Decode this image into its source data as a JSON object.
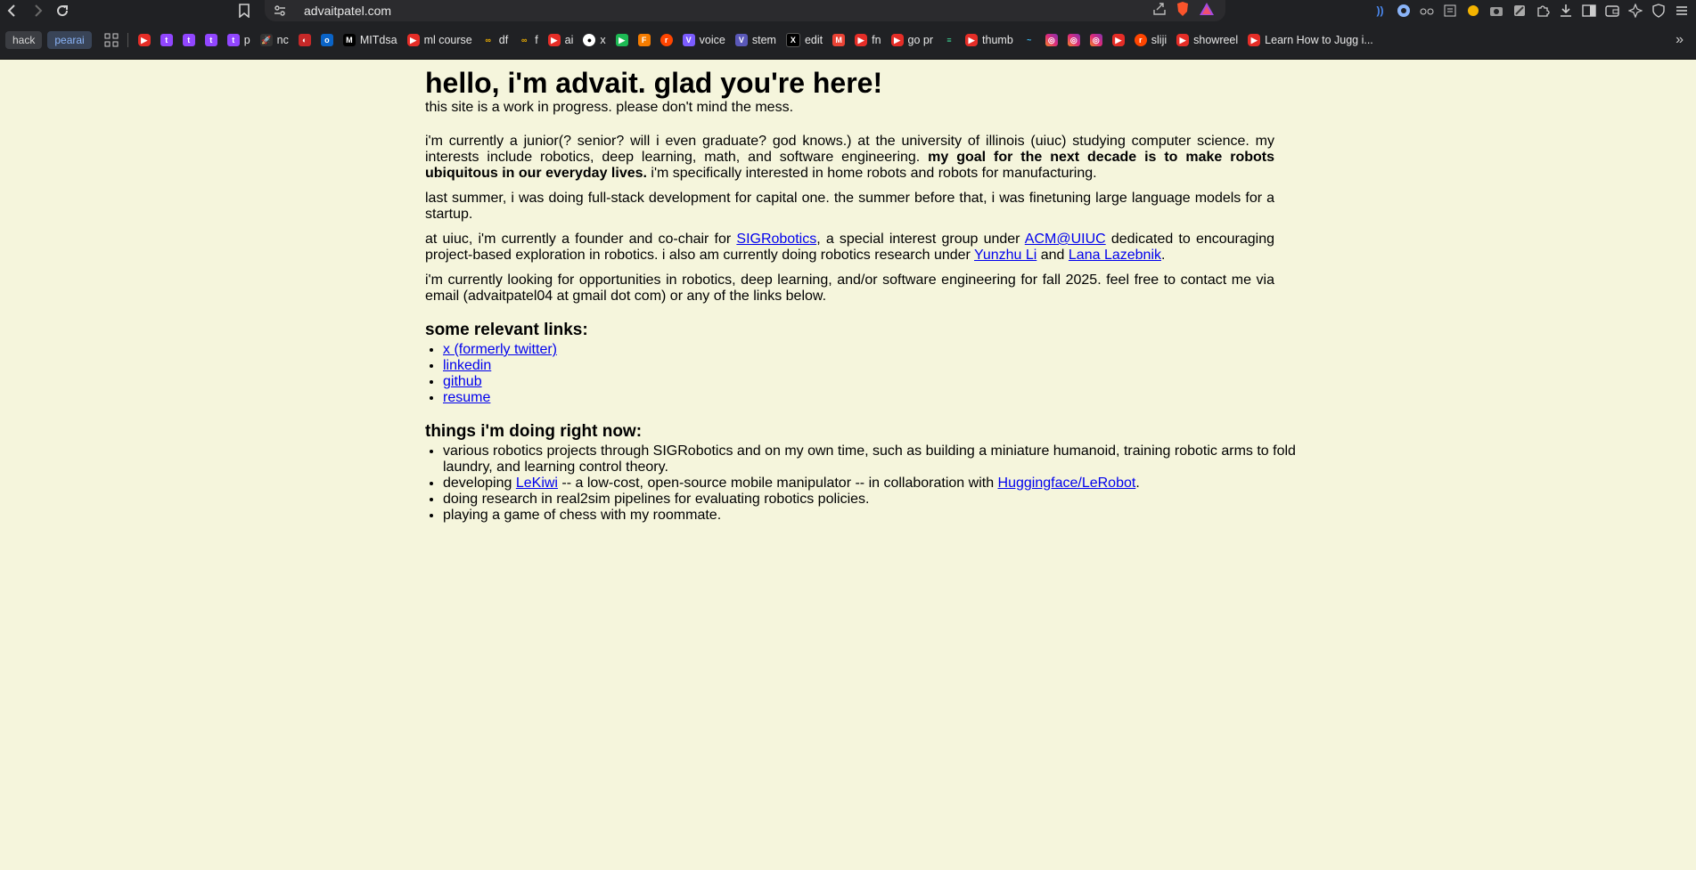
{
  "browser": {
    "url": "advaitpatel.com",
    "bookmarks": [
      {
        "label": "hack",
        "type": "tag"
      },
      {
        "label": "pearai",
        "type": "tag-blue"
      },
      {
        "label": "",
        "icon": "youtube-icon"
      },
      {
        "label": "",
        "icon": "twitch-icon"
      },
      {
        "label": "",
        "icon": "twitch-icon"
      },
      {
        "label": "",
        "icon": "twitch-icon"
      },
      {
        "label": "p",
        "icon": "twitch-icon"
      },
      {
        "label": "nc",
        "icon": "rocket-icon"
      },
      {
        "label": "",
        "icon": "gauge-icon"
      },
      {
        "label": "",
        "icon": "outlook-icon"
      },
      {
        "label": "MITdsa",
        "icon": "mit-icon"
      },
      {
        "label": "ml course",
        "icon": "youtube-icon"
      },
      {
        "label": "df",
        "icon": "infinity-icon"
      },
      {
        "label": "f",
        "icon": "infinity-icon"
      },
      {
        "label": "ai",
        "icon": "youtube-icon"
      },
      {
        "label": "x",
        "icon": "github-icon"
      },
      {
        "label": "",
        "icon": "play-icon"
      },
      {
        "label": "",
        "icon": "f-icon"
      },
      {
        "label": "",
        "icon": "reddit-icon"
      },
      {
        "label": "voice",
        "icon": "v-icon"
      },
      {
        "label": "stem",
        "icon": "v-box-icon"
      },
      {
        "label": "edit",
        "icon": "x-icon"
      },
      {
        "label": "",
        "icon": "gmail-icon"
      },
      {
        "label": "fn",
        "icon": "youtube-icon"
      },
      {
        "label": "go pr",
        "icon": "youtube-icon"
      },
      {
        "label": "",
        "icon": "stripes-icon"
      },
      {
        "label": "thumb",
        "icon": "youtube-icon"
      },
      {
        "label": "",
        "icon": "tailwind-icon"
      },
      {
        "label": "",
        "icon": "instagram-icon"
      },
      {
        "label": "",
        "icon": "instagram-icon"
      },
      {
        "label": "",
        "icon": "instagram-icon"
      },
      {
        "label": "",
        "icon": "youtube-icon"
      },
      {
        "label": "sliji",
        "icon": "reddit-icon"
      },
      {
        "label": "showreel",
        "icon": "youtube-icon"
      },
      {
        "label": "Learn How to Jugg i...",
        "icon": "youtube-icon"
      }
    ]
  },
  "page": {
    "title": "hello, i'm advait. glad you're here!",
    "subtitle": "this site is a work in progress. please don't mind the mess.",
    "p1_a": "i'm currently a junior(? senior? will i even graduate? god knows.) at the university of illinois (uiuc) studying computer science. my interests include robotics, deep learning, math, and software engineering. ",
    "p1_bold": "my goal for the next decade is to make robots ubiquitous in our everyday lives.",
    "p1_b": " i'm specifically interested in home robots and robots for manufacturing.",
    "p2": "last summer, i was doing full-stack development for capital one. the summer before that, i was finetuning large language models for a startup.",
    "p3_a": "at uiuc, i'm currently a founder and co-chair for ",
    "p3_link1": "SIGRobotics",
    "p3_b": ", a special interest group under ",
    "p3_link2": "ACM@UIUC",
    "p3_c": " dedicated to encouraging project-based exploration in robotics. i also am currently doing robotics research under ",
    "p3_link3": "Yunzhu Li",
    "p3_d": " and ",
    "p3_link4": "Lana Lazebnik",
    "p3_e": ".",
    "p4": "i'm currently looking for opportunities in robotics, deep learning, and/or software engineering for fall 2025. feel free to contact me via email (advaitpatel04 at gmail dot com) or any of the links below.",
    "links_heading": "some relevant links:",
    "links": [
      "x (formerly twitter)",
      "linkedin",
      "github",
      "resume"
    ],
    "now_heading": "things i'm doing right now:",
    "now_1": "various robotics projects through SIGRobotics and on my own time, such as building a miniature humanoid, training robotic arms to fold laundry, and learning control theory.",
    "now_2_a": "developing ",
    "now_2_link1": "LeKiwi",
    "now_2_b": " -- a low-cost, open-source mobile manipulator -- in collaboration with ",
    "now_2_link2": "Huggingface/LeRobot",
    "now_2_c": ".",
    "now_3": "doing research in real2sim pipelines for evaluating robotics policies.",
    "now_4": "playing a game of chess with my roommate."
  }
}
